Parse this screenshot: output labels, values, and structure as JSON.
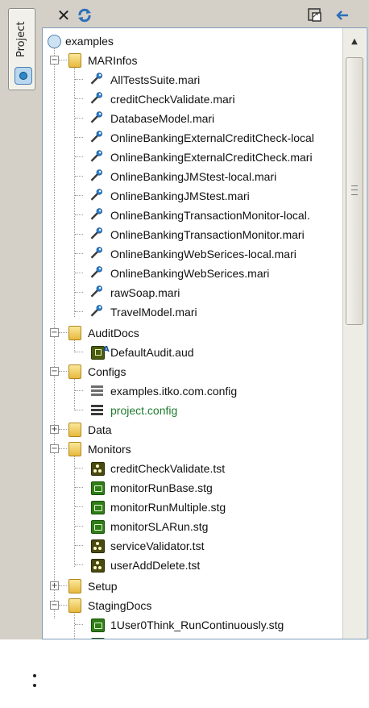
{
  "side_tab": {
    "label": "Project",
    "icon": "project-icon"
  },
  "toolbar": {
    "close_icon": "close-icon",
    "refresh_icon": "refresh-icon",
    "maximize_icon": "maximize-icon",
    "minimize_icon": "minimize-icon"
  },
  "tree": {
    "root": "examples",
    "marinfos": {
      "label": "MARInfos",
      "items": [
        "AllTestsSuite.mari",
        "creditCheckValidate.mari",
        "DatabaseModel.mari",
        "OnlineBankingExternalCreditCheck-local",
        "OnlineBankingExternalCreditCheck.mari",
        "OnlineBankingJMStest-local.mari",
        "OnlineBankingJMStest.mari",
        "OnlineBankingTransactionMonitor-local.",
        "OnlineBankingTransactionMonitor.mari",
        "OnlineBankingWebSerices-local.mari",
        "OnlineBankingWebSerices.mari",
        "rawSoap.mari",
        "TravelModel.mari"
      ]
    },
    "auditdocs": {
      "label": "AuditDocs",
      "items": [
        "DefaultAudit.aud"
      ],
      "badge": "A"
    },
    "configs": {
      "label": "Configs",
      "items": [
        "examples.itko.com.config",
        "project.config"
      ]
    },
    "data": {
      "label": "Data"
    },
    "monitors": {
      "label": "Monitors",
      "items": [
        "creditCheckValidate.tst",
        "monitorRunBase.stg",
        "monitorRunMultiple.stg",
        "monitorSLARun.stg",
        "serviceValidator.tst",
        "userAddDelete.tst"
      ]
    },
    "setup": {
      "label": "Setup"
    },
    "stagingdocs": {
      "label": "StagingDocs",
      "items": [
        "1User0Think_RunContinuously.stg"
      ]
    },
    "expand_collapsed": "+",
    "expand_open": "−"
  },
  "colors": {
    "active_config": "#1f7a2e",
    "panel_border": "#7f9db9"
  }
}
